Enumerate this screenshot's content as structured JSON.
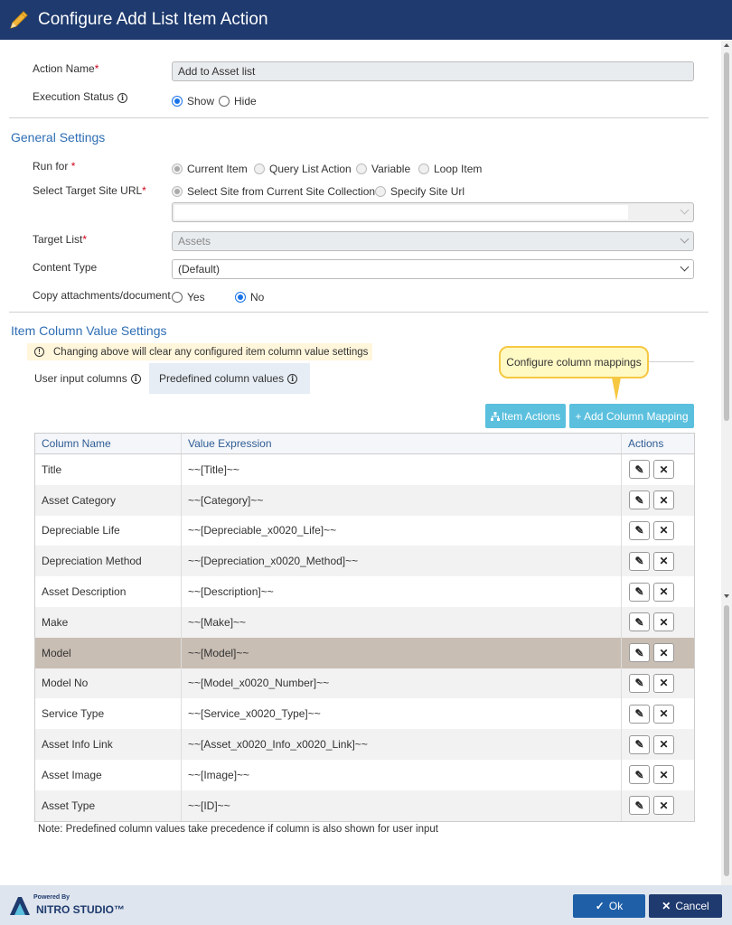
{
  "title": "Configure Add List Item Action",
  "form": {
    "action_name_label": "Action Name",
    "action_name_value": "Add to Asset list",
    "execution_status_label": "Execution Status",
    "execution_status_options": [
      "Show",
      "Hide"
    ],
    "execution_status_selected": "Show"
  },
  "general": {
    "heading": "General Settings",
    "run_for_label": "Run for",
    "run_for_options": [
      "Current Item",
      "Query List Action",
      "Variable",
      "Loop Item"
    ],
    "run_for_selected": "Current Item",
    "target_site_label": "Select Target Site URL",
    "target_site_options": [
      "Select Site from Current Site Collection",
      "Specify Site Url"
    ],
    "target_site_selected": "Select Site from Current Site Collection",
    "site_select_value": "",
    "target_list_label": "Target List",
    "target_list_value": "Assets",
    "content_type_label": "Content Type",
    "content_type_value": "(Default)",
    "copy_attachments_label": "Copy attachments/document",
    "copy_attachments_options": [
      "Yes",
      "No"
    ],
    "copy_attachments_selected": "No"
  },
  "item_columns": {
    "heading": "Item Column Value Settings",
    "warning": "Changing above will clear any configured item column value settings",
    "tabs": [
      "User input columns",
      "Predefined column values"
    ],
    "active_tab": "Predefined column values",
    "tooltip": "Configure column mappings",
    "item_actions_button": "Item Actions",
    "add_mapping_button": "+ Add Column Mapping",
    "columns": [
      "Column Name",
      "Value Expression",
      "Actions"
    ],
    "rows": [
      {
        "name": "Title",
        "expr": "~~[Title]~~"
      },
      {
        "name": "Asset Category",
        "expr": "~~[Category]~~"
      },
      {
        "name": "Depreciable Life",
        "expr": "~~[Depreciable_x0020_Life]~~"
      },
      {
        "name": "Depreciation Method",
        "expr": "~~[Depreciation_x0020_Method]~~"
      },
      {
        "name": "Asset Description",
        "expr": "~~[Description]~~"
      },
      {
        "name": "Make",
        "expr": "~~[Make]~~"
      },
      {
        "name": "Model",
        "expr": "~~[Model]~~"
      },
      {
        "name": "Model No",
        "expr": "~~[Model_x0020_Number]~~"
      },
      {
        "name": "Service Type",
        "expr": "~~[Service_x0020_Type]~~"
      },
      {
        "name": "Asset Info Link",
        "expr": "~~[Asset_x0020_Info_x0020_Link]~~"
      },
      {
        "name": "Asset Image",
        "expr": "~~[Image]~~"
      },
      {
        "name": "Asset Type",
        "expr": "~~[ID]~~"
      }
    ],
    "selected_row": "Model",
    "note": "Note: Predefined column values take precedence if column is also shown for user input"
  },
  "footer": {
    "powered_by": "Powered By",
    "brand": "NITRO STUDIO™",
    "ok_label": "Ok",
    "cancel_label": "Cancel"
  },
  "colors": {
    "header": "#1e3a6e",
    "section": "#2e6db4",
    "accent_button": "#5bc0de",
    "ok_button": "#1e5fa8"
  }
}
